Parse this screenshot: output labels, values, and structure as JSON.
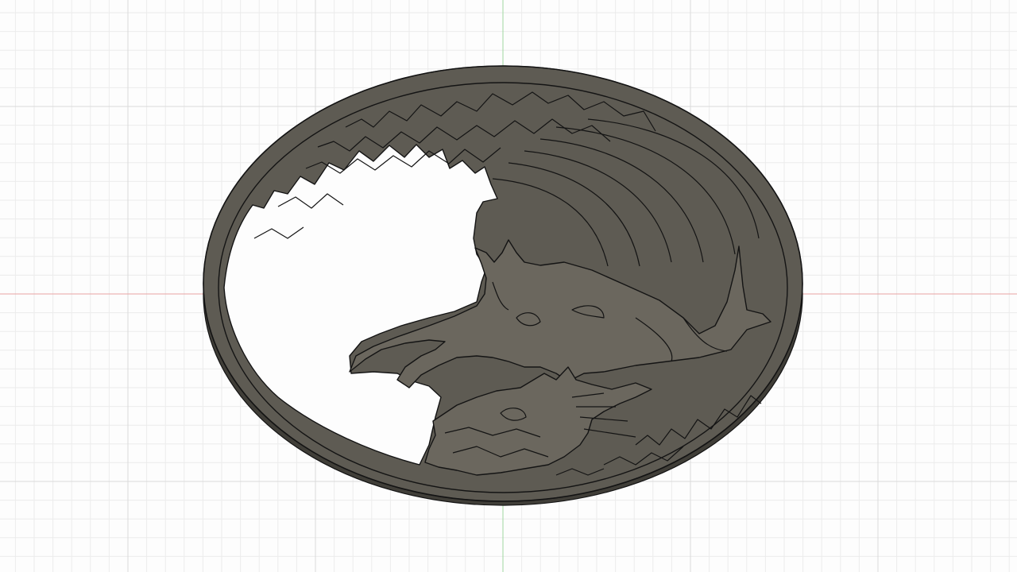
{
  "viewport": {
    "background": "#fdfdfd",
    "grid_minor_color": "#ececec",
    "grid_major_color": "#dadada",
    "axis_x_color": "#e9a3a3",
    "axis_y_color": "#9fd79f"
  },
  "model": {
    "name": "coaster-medallion",
    "body_color": "#5e5b53",
    "side_color": "#403e38",
    "relief_color": "#6b675e",
    "edge_color": "#141414",
    "cutout_color": "#fdfdfd"
  }
}
